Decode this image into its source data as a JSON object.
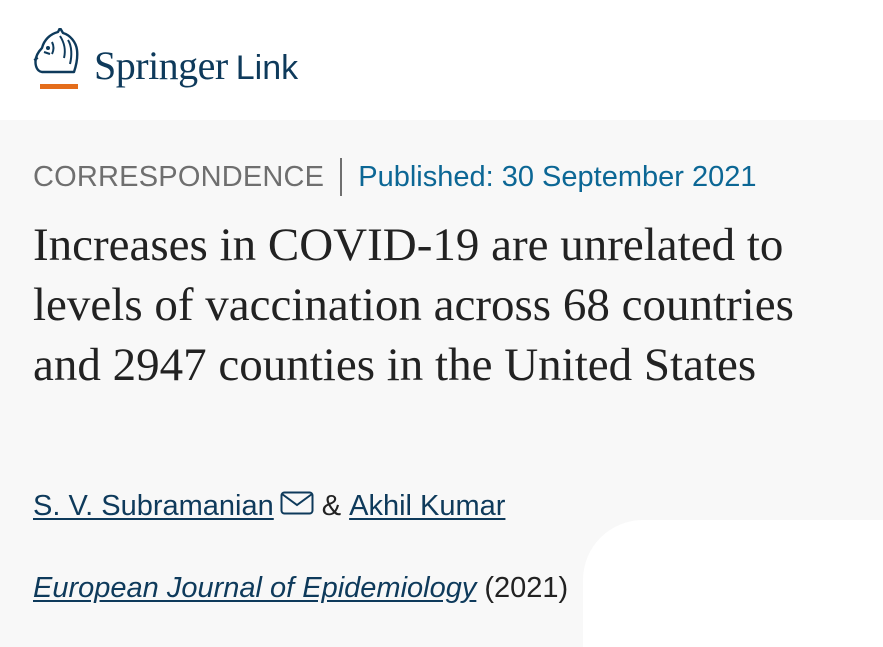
{
  "header": {
    "brand_primary": "Springer",
    "brand_secondary": "Link",
    "logo_icon": "horse-head-icon",
    "colors": {
      "brand": "#0e3a5b",
      "accent": "#e46d1b"
    }
  },
  "article": {
    "type": "CORRESPONDENCE",
    "published": "Published: 30 September 2021",
    "title": "Increases in COVID-19 are unrelated to levels of vaccination across 68 countries and 2947 counties in the United States",
    "authors": [
      "S. V. Subramanian",
      "Akhil Kumar"
    ],
    "author_separator": "&",
    "mail_icon": "envelope-icon",
    "journal": "European Journal of Epidemiology",
    "year": "(2021)",
    "colors": {
      "type_text": "#6f6f6f",
      "published_text": "#0c6795",
      "title_text": "#222222",
      "link": "#0e3a5b"
    }
  }
}
